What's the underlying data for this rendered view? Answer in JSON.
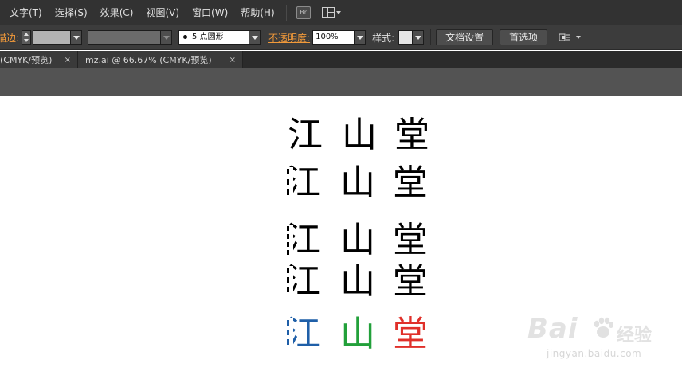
{
  "menubar": {
    "items": [
      "文字(T)",
      "选择(S)",
      "效果(C)",
      "视图(V)",
      "窗口(W)",
      "帮助(H)"
    ],
    "bridge_icon_text": "Br"
  },
  "controlbar": {
    "stroke_label": "描边:",
    "brush_value": "5 点圆形",
    "opacity_label": "不透明度:",
    "opacity_value": "100%",
    "style_label": "样式:",
    "doc_setup_button": "文档设置",
    "preferences_button": "首选项",
    "stroke_color": "#b3b3b3",
    "fill_color": "#6b6b6b",
    "style_swatch_color": "#e6e6e6"
  },
  "tabs": [
    {
      "label": "(CMYK/预览)",
      "close": "×"
    },
    {
      "label": "mz.ai @ 66.67% (CMYK/预览)",
      "close": "×"
    }
  ],
  "artwork": {
    "rows": [
      {
        "chars": [
          "江",
          "山",
          "堂"
        ],
        "colors": [
          "#000000",
          "#000000",
          "#000000"
        ]
      },
      {
        "chars": [
          "江",
          "山",
          "堂"
        ],
        "colors": [
          "#000000",
          "#000000",
          "#000000"
        ]
      },
      {
        "chars": [
          "江",
          "山",
          "堂"
        ],
        "colors": [
          "#000000",
          "#000000",
          "#000000"
        ]
      },
      {
        "chars": [
          "江",
          "山",
          "堂"
        ],
        "colors": [
          "#000000",
          "#000000",
          "#000000"
        ]
      },
      {
        "chars": [
          "江",
          "山",
          "堂"
        ],
        "colors": [
          "#1f5fa8",
          "#22a03a",
          "#e0302a"
        ]
      }
    ]
  },
  "watermark": {
    "logo_text": "Bai",
    "logo_suffix": "经验",
    "url": "jingyan.baidu.com"
  }
}
